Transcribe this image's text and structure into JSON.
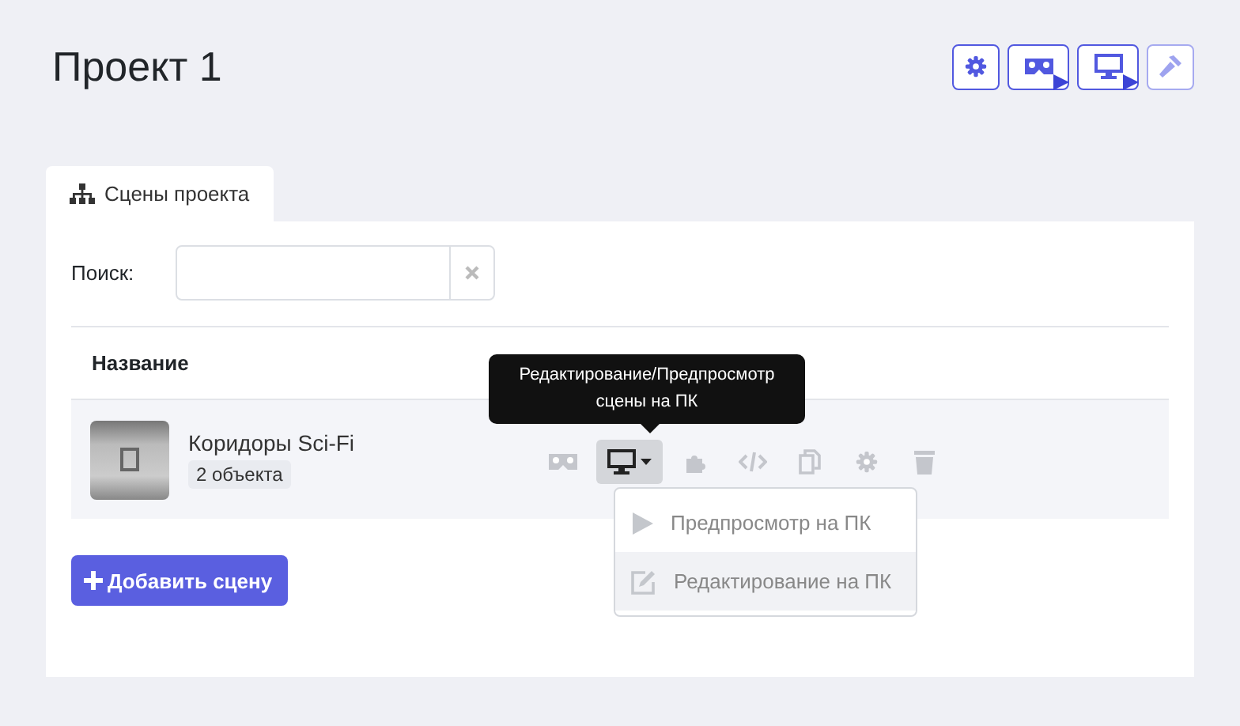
{
  "title": "Проект 1",
  "toolbar": [
    {
      "kind": "settings",
      "disabled": false
    },
    {
      "kind": "vr",
      "disabled": false
    },
    {
      "kind": "desktop",
      "disabled": false
    },
    {
      "kind": "build",
      "disabled": true
    }
  ],
  "tabs": [
    {
      "label": "Сцены проекта",
      "selected": true
    }
  ],
  "search": {
    "label": "Поиск:"
  },
  "table": {
    "columns": [
      "Название"
    ],
    "rows": [
      {
        "name": "Коридоры Sci-Fi",
        "badge": "2 объекта",
        "actions": [
          {
            "kind": "vr",
            "active": false
          },
          {
            "kind": "desktop",
            "active": true
          },
          {
            "kind": "puzzle",
            "active": false
          },
          {
            "kind": "code",
            "active": false
          },
          {
            "kind": "copy",
            "active": false
          },
          {
            "kind": "settings",
            "active": false
          },
          {
            "kind": "trash",
            "active": false
          }
        ]
      }
    ]
  },
  "tooltip": "Редактирование/Предпросмотр сцены на ПК",
  "dropdown": [
    {
      "label": "Предпросмотр на ПК",
      "kind": "play",
      "highlighted": false
    },
    {
      "label": "Редактирование на ПК",
      "kind": "edit",
      "highlighted": true
    }
  ],
  "add_button": "Добавить сцену"
}
